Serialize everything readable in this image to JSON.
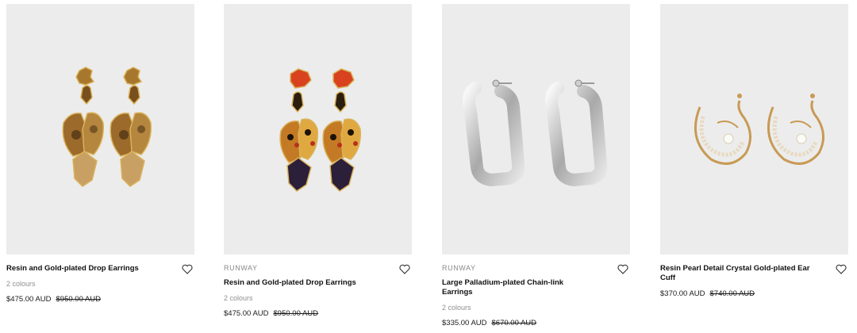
{
  "products": [
    {
      "tag": "",
      "title": "Resin and Gold-plated Drop Earrings",
      "colours": "2 colours",
      "price": "$475.00 AUD",
      "original_price": "$950.00 AUD",
      "image_icon": "tortoiseshell-drop-earrings-image"
    },
    {
      "tag": "RUNWAY",
      "title": "Resin and Gold-plated Drop Earrings",
      "colours": "2 colours",
      "price": "$475.00 AUD",
      "original_price": "$950.00 AUD",
      "image_icon": "printed-drop-earrings-image"
    },
    {
      "tag": "RUNWAY",
      "title": "Large Palladium-plated Chain-link Earrings",
      "colours": "2 colours",
      "price": "$335.00 AUD",
      "original_price": "$670.00 AUD",
      "image_icon": "chain-link-earrings-image"
    },
    {
      "tag": "",
      "title": "Resin Pearl Detail Crystal Gold-plated Ear Cuff",
      "colours": "",
      "price": "$370.00 AUD",
      "original_price": "$740.00 AUD",
      "image_icon": "pearl-ear-cuff-image"
    }
  ],
  "colors": {
    "image_background": "#ececec",
    "muted_text": "#8f8f8f",
    "primary_text": "#111111"
  },
  "icons": {
    "wishlist": "heart-outline-icon"
  }
}
